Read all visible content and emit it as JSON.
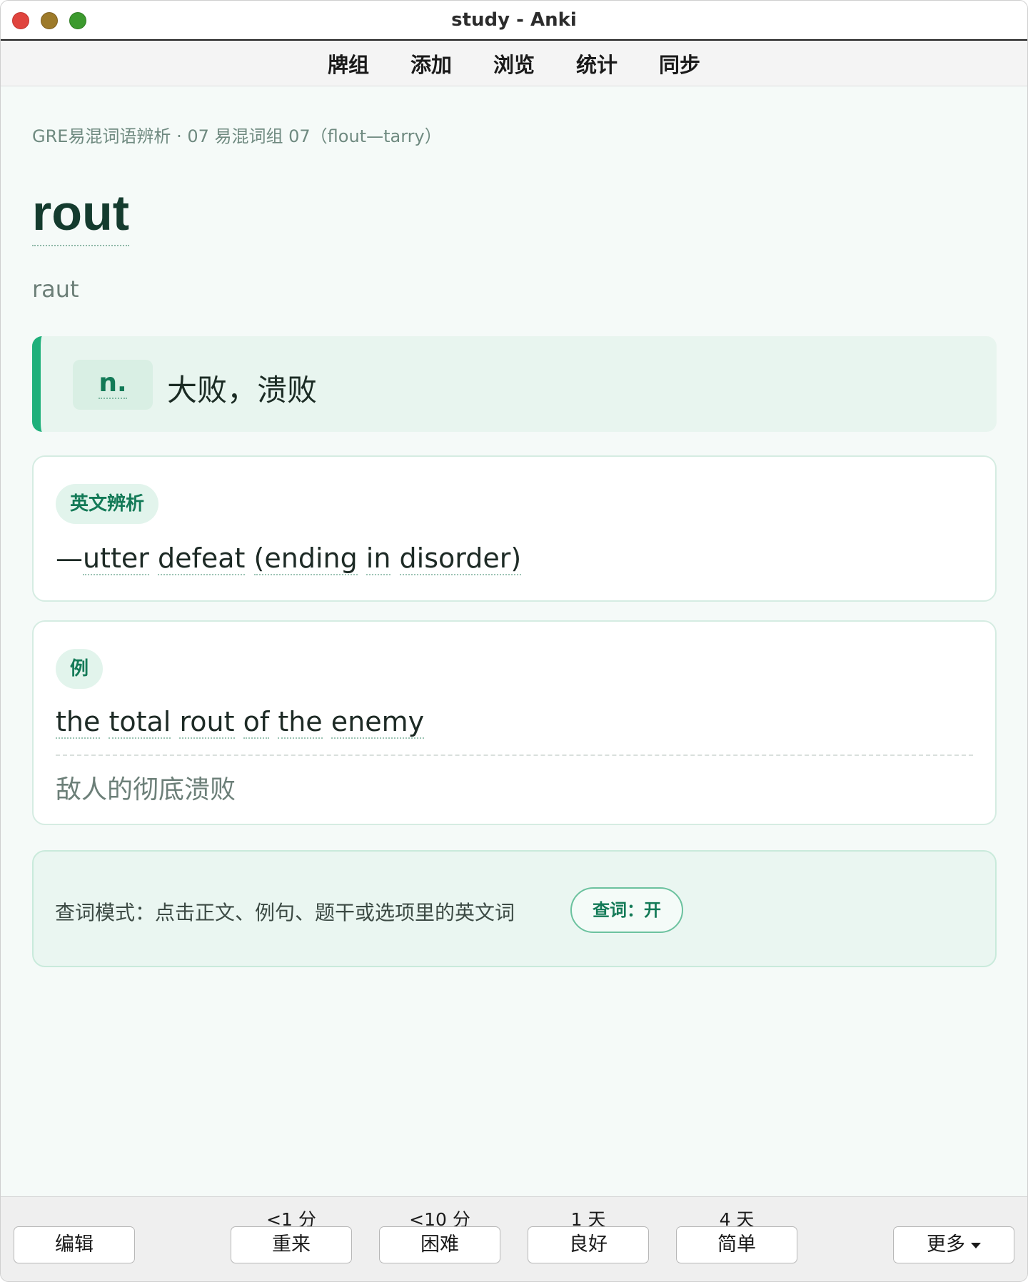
{
  "window": {
    "title": "study - Anki"
  },
  "toolbar": {
    "items": [
      "牌组",
      "添加",
      "浏览",
      "统计",
      "同步"
    ]
  },
  "card": {
    "breadcrumb": "GRE易混词语辨析 · 07 易混词组 07（flout—tarry）",
    "headword": "rout",
    "phonetic": "raut",
    "pos": "n.",
    "definition": "大败，溃败",
    "english_label": "英文辨析",
    "english_prefix": "—",
    "english_words": [
      "utter",
      "defeat",
      "(ending",
      "in",
      "disorder)"
    ],
    "example_label": "例",
    "example_words": [
      "the",
      "total",
      "rout",
      "of",
      "the",
      "enemy"
    ],
    "example_translation": "敌人的彻底溃败",
    "lookup_text": "查词模式：点击正文、例句、题干或选项里的英文词",
    "lookup_button": "查词：开"
  },
  "bottom": {
    "edit_label": "编辑",
    "more_label": "更多",
    "answers": [
      {
        "interval": "<1 分",
        "label": "重来"
      },
      {
        "interval": "<10 分",
        "label": "困难"
      },
      {
        "interval": "1 天",
        "label": "良好"
      },
      {
        "interval": "4 天",
        "label": "简单"
      }
    ]
  },
  "colors": {
    "accent": "#1fb07b",
    "headword": "#143b2e",
    "tag_text": "#137a57"
  }
}
